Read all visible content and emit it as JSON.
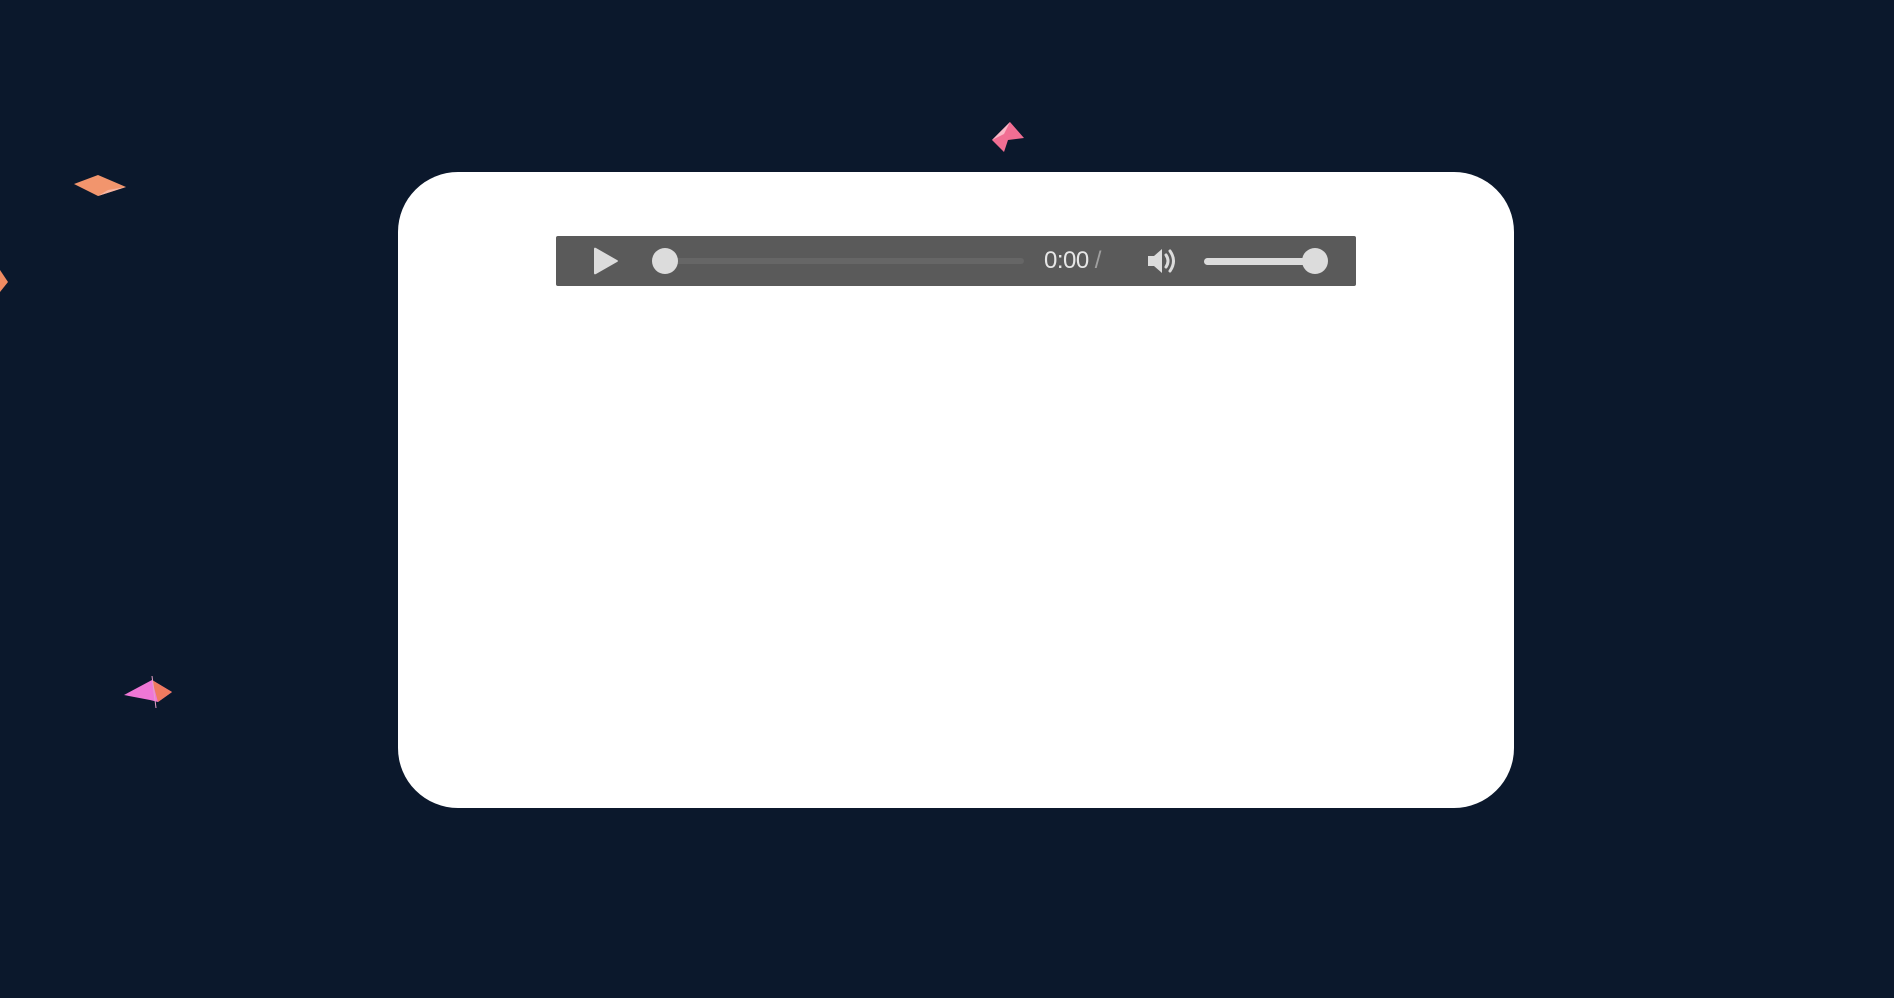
{
  "player": {
    "current_time": "0:00",
    "time_separator": "/",
    "progress": 0,
    "volume": 1,
    "play_icon": "play-icon",
    "volume_icon": "speaker-volume-icon"
  },
  "colors": {
    "background": "#0b182c",
    "card": "#ffffff",
    "player_bar": "#5a5a5a",
    "controls": "#dcdcdc"
  }
}
